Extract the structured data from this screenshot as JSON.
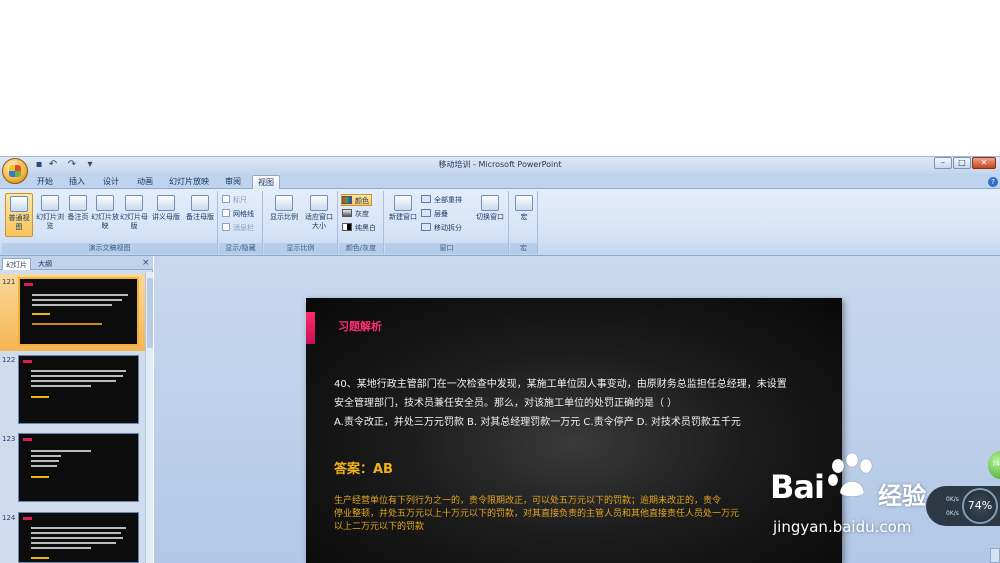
{
  "window": {
    "title": "移动培训 - Microsoft PowerPoint"
  },
  "qat": {
    "save": "▪",
    "undo": "↶",
    "redo": "↷",
    "customize": "▾"
  },
  "window_controls": {
    "minimize": "–",
    "maximize": "□",
    "close": "✕"
  },
  "tabs": [
    "开始",
    "插入",
    "设计",
    "动画",
    "幻灯片放映",
    "审阅",
    "视图"
  ],
  "active_tab": "视图",
  "ribbon": {
    "views_group": {
      "label": "演示文稿视图",
      "buttons": [
        "普通视图",
        "幻灯片浏览",
        "备注页",
        "幻灯片放映",
        "幻灯片母版",
        "讲义母版",
        "备注母版"
      ]
    },
    "show_hide_group": {
      "label": "显示/隐藏",
      "items": [
        "标尺",
        "网格线",
        "消息栏"
      ]
    },
    "zoom_group": {
      "label": "显示比例",
      "buttons": [
        "显示比例",
        "适应窗口大小"
      ]
    },
    "color_group": {
      "label": "颜色/灰度",
      "items": [
        "颜色",
        "灰度",
        "纯黑白"
      ]
    },
    "window_group": {
      "label": "窗口",
      "new_window": "新建窗口",
      "items": [
        "全部重排",
        "层叠",
        "移动拆分"
      ],
      "switch": "切换窗口"
    },
    "macro_group": {
      "label": "宏",
      "button": "宏"
    }
  },
  "pane": {
    "tabs": [
      "幻灯片",
      "大纲"
    ],
    "close": "×"
  },
  "thumbnails": [
    {
      "number": "121"
    },
    {
      "number": "122"
    },
    {
      "number": "123"
    },
    {
      "number": "124"
    }
  ],
  "slide": {
    "title": "习题解析",
    "question_lines": [
      "40、某地行政主管部门在一次检查中发现，某施工单位因人事变动，由原财务总监担任总经理，未设置",
      "安全管理部门，技术员兼任安全员。那么，对该施工单位的处罚正确的是（    ）",
      "A.责令改正，并处三万元罚款  B. 对其总经理罚款一万元   C.责令停产    D. 对技术员罚款五千元"
    ],
    "answer": "答案：AB",
    "explanation_lines": [
      "生产经营单位有下列行为之一的，责令限期改正，可以处五万元以下的罚款；逾期未改正的，责令",
      "停业整顿，并处五万元以上十万元以下的罚款，对其直接负责的主管人员和其他直接责任人员处一万元",
      "以上二万元以下的罚款"
    ]
  },
  "watermark": {
    "logo": "Bai",
    "logo2": "经验",
    "url": "jingyan.baidu.com"
  },
  "net_widget": {
    "percent": "74%",
    "up": "0K/s",
    "down": "0K/s",
    "ball": "74"
  }
}
